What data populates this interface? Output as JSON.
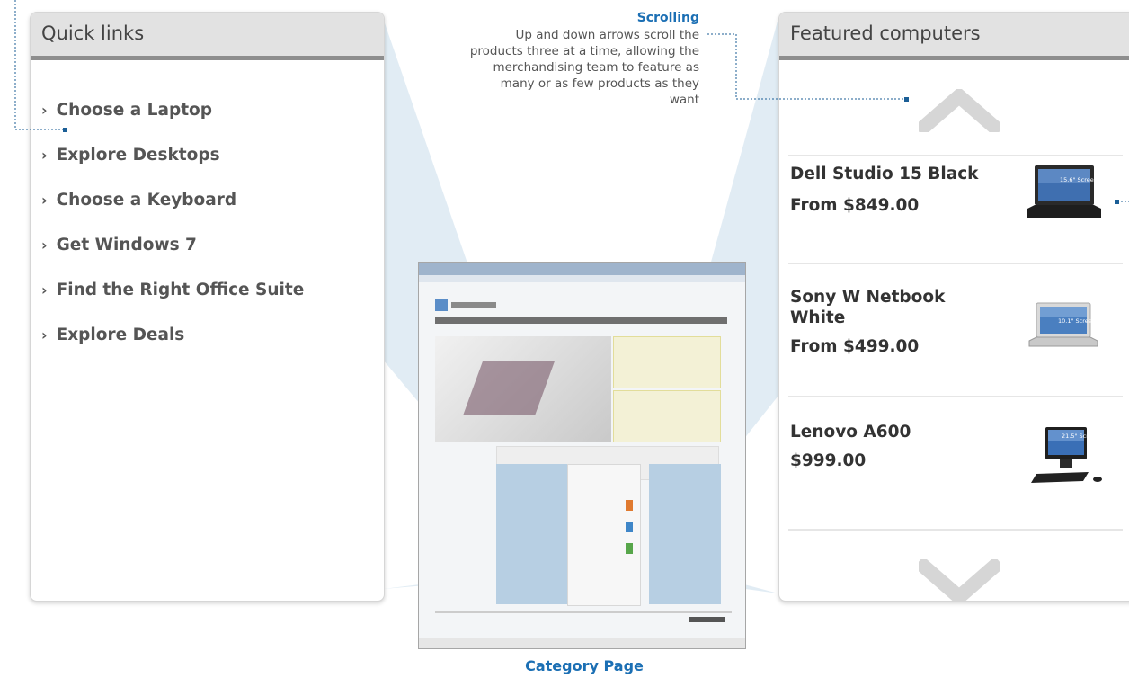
{
  "quick_links": {
    "title": "Quick links",
    "items": [
      {
        "label": "Choose a Laptop"
      },
      {
        "label": "Explore Desktops"
      },
      {
        "label": "Choose a Keyboard"
      },
      {
        "label": "Get Windows 7"
      },
      {
        "label": "Find the Right Office Suite"
      },
      {
        "label": "Explore Deals"
      }
    ]
  },
  "featured": {
    "title": "Featured computers",
    "products": [
      {
        "name": "Dell Studio 15 Black",
        "price": "From $849.00",
        "screen_label": "15.6\" Screen",
        "icon": "laptop-icon"
      },
      {
        "name": "Sony W Netbook White",
        "price": "From $499.00",
        "screen_label": "10.1\" Screen",
        "icon": "netbook-icon"
      },
      {
        "name": "Lenovo A600",
        "price": "$999.00",
        "screen_label": "21.5\" Screen",
        "icon": "desktop-icon"
      }
    ]
  },
  "callout": {
    "title": "Scrolling",
    "description": "Up and down arrows scroll the products three at a time, allowing the merchandising team to feature as many or as few products as they want"
  },
  "caption": "Category Page",
  "colors": {
    "callout_blue": "#1b6fb4",
    "leader_line": "#1b5e96",
    "header_gray": "#e2e2e2",
    "header_rule": "#8e8e8e",
    "wedge_fill": "#d5e3ef"
  }
}
